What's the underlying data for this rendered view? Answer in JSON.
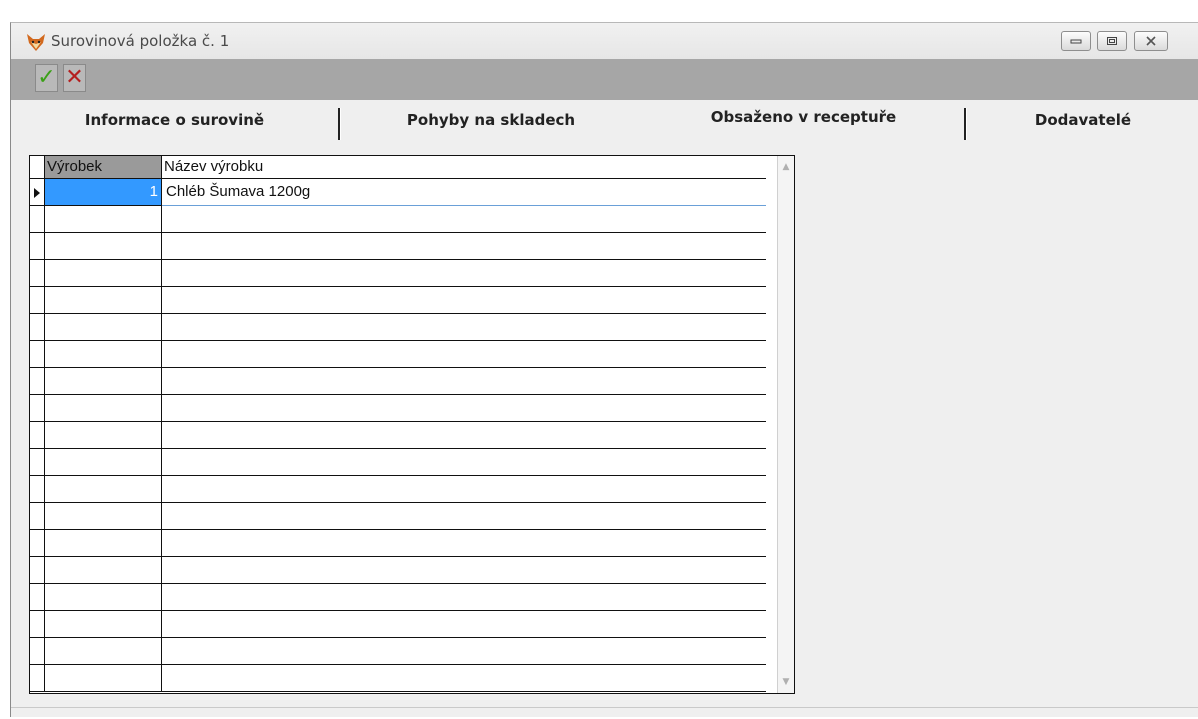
{
  "window": {
    "title": "Surovinová položka č. 1",
    "icon": "fox-icon",
    "controls": [
      "minimize-icon",
      "maximize-icon",
      "close-icon"
    ]
  },
  "toolbar": {
    "confirm_icon": "✓",
    "cancel_icon": "✕"
  },
  "tabs": [
    {
      "label": "Informace o surovině",
      "active": false
    },
    {
      "label": "Pohyby na skladech",
      "active": false
    },
    {
      "label": "Obsaženo v receptuře",
      "active": true
    },
    {
      "label": "Dodavatelé",
      "active": false
    }
  ],
  "grid": {
    "columns": [
      "Výrobek",
      "Název výrobku"
    ],
    "rows": [
      {
        "vyrobek": "1",
        "nazev": "Chléb Šumava 1200g",
        "selected": true
      },
      {
        "vyrobek": "",
        "nazev": ""
      },
      {
        "vyrobek": "",
        "nazev": ""
      },
      {
        "vyrobek": "",
        "nazev": ""
      },
      {
        "vyrobek": "",
        "nazev": ""
      },
      {
        "vyrobek": "",
        "nazev": ""
      },
      {
        "vyrobek": "",
        "nazev": ""
      },
      {
        "vyrobek": "",
        "nazev": ""
      },
      {
        "vyrobek": "",
        "nazev": ""
      },
      {
        "vyrobek": "",
        "nazev": ""
      },
      {
        "vyrobek": "",
        "nazev": ""
      },
      {
        "vyrobek": "",
        "nazev": ""
      },
      {
        "vyrobek": "",
        "nazev": ""
      },
      {
        "vyrobek": "",
        "nazev": ""
      },
      {
        "vyrobek": "",
        "nazev": ""
      },
      {
        "vyrobek": "",
        "nazev": ""
      },
      {
        "vyrobek": "",
        "nazev": ""
      },
      {
        "vyrobek": "",
        "nazev": ""
      },
      {
        "vyrobek": "",
        "nazev": ""
      }
    ]
  },
  "colors": {
    "selection": "#3399ff",
    "confirm": "#3aa016",
    "cancel": "#b51e1e"
  }
}
